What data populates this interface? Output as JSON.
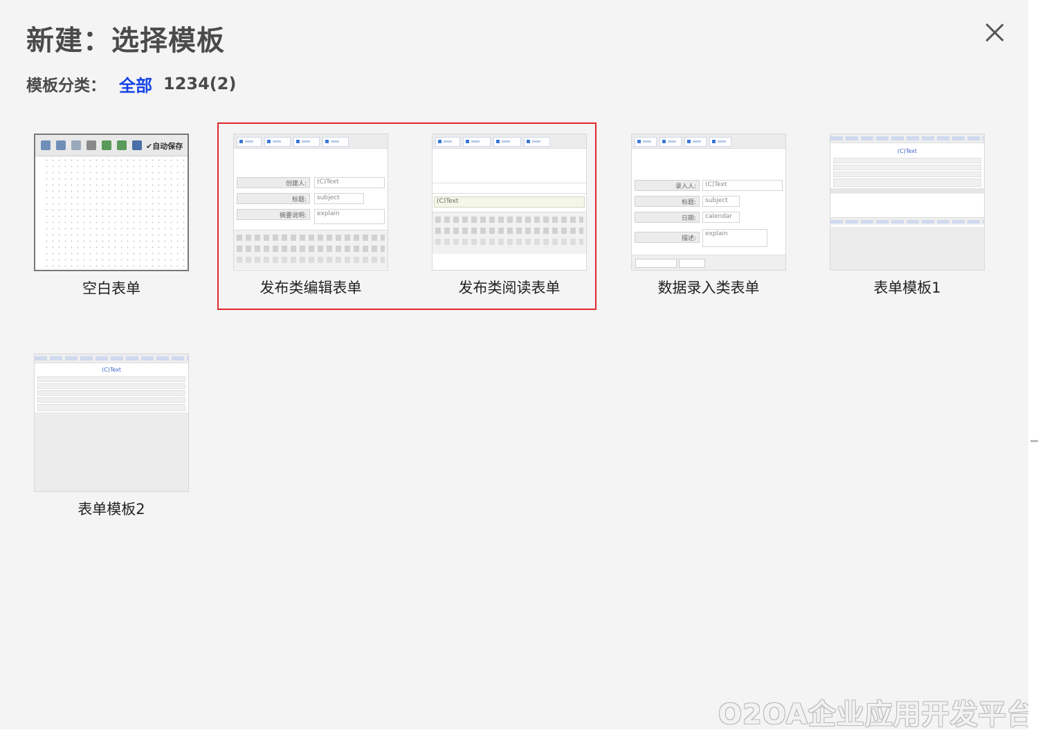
{
  "dialog": {
    "title": "新建：选择模板",
    "close_icon": "close-icon"
  },
  "categories": {
    "label": "模板分类：",
    "items": [
      {
        "label": "全部",
        "active": true
      },
      {
        "label": "1234(2)",
        "active": false
      }
    ]
  },
  "templates": [
    {
      "name": "空白表单",
      "highlighted": false
    },
    {
      "name": "发布类编辑表单",
      "highlighted": true
    },
    {
      "name": "发布类阅读表单",
      "highlighted": true
    },
    {
      "name": "数据录入类表单",
      "highlighted": false
    },
    {
      "name": "表单模板1",
      "highlighted": false
    },
    {
      "name": "表单模板2",
      "highlighted": false
    }
  ],
  "previews": {
    "blank": {
      "autosave": "✔自动保存"
    },
    "edit": {
      "fields": [
        "创建人:",
        "标题:",
        "摘要说明:"
      ],
      "values": [
        "(C)Text",
        "subject",
        "explain"
      ]
    },
    "read": {
      "value": "(C)Text"
    },
    "entry": {
      "fields": [
        "录入人:",
        "标题:",
        "日期:",
        "描述:"
      ],
      "values": [
        "(C)Text",
        "subject",
        "calendar",
        "explain"
      ]
    },
    "tpl1": {
      "heading": "(C)Text"
    },
    "tpl2": {
      "heading": "(C)Text"
    }
  },
  "watermark": "O2OA企业应用开发平台",
  "colors": {
    "accent": "#1442e6",
    "highlight_border": "#e0262a",
    "background": "#f4f4f4"
  }
}
